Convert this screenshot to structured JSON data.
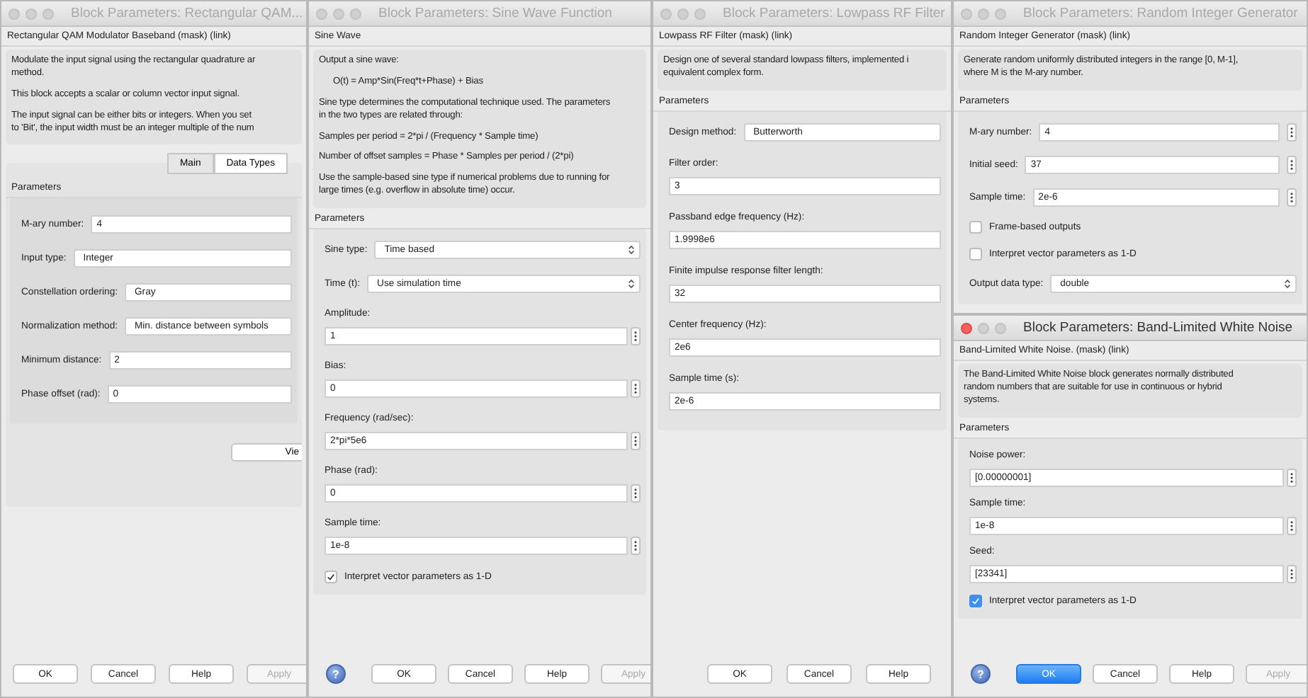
{
  "windows": [
    {
      "title": "Block Parameters: Rectangular QAM...",
      "active": false,
      "header": "Rectangular QAM Modulator Baseband (mask) (link)",
      "description": [
        {
          "indented": false,
          "lines": [
            "Modulate the input signal using the rectangular quadrature ar",
            "method."
          ]
        },
        {
          "indented": false,
          "lines": [
            "This block accepts a scalar or column vector input signal."
          ]
        },
        {
          "indented": false,
          "lines": [
            "The input signal can be either bits or integers. When you set",
            "to 'Bit', the input width must be an integer multiple of the num"
          ]
        }
      ],
      "tabs": [
        {
          "label": "Main",
          "selected": true
        },
        {
          "label": "Data Types",
          "selected": false
        }
      ],
      "params_title": "Parameters",
      "params": [
        {
          "kind": "inline-field",
          "label": "M-ary number:",
          "value": "4"
        },
        {
          "kind": "inline-select",
          "label": "Input type:",
          "value": "Integer"
        },
        {
          "kind": "inline-select",
          "label": "Constellation ordering:",
          "value": "Gray"
        },
        {
          "kind": "inline-select",
          "label": "Normalization method:",
          "value": "Min. distance between symbols"
        },
        {
          "kind": "inline-field",
          "label": "Minimum distance:",
          "value": "2"
        },
        {
          "kind": "inline-field",
          "label": "Phase offset (rad):",
          "value": "0"
        }
      ],
      "panel_button": "Vie",
      "buttons": [
        {
          "label": "OK",
          "default": false,
          "disabled": false
        },
        {
          "label": "Cancel",
          "default": false,
          "disabled": false
        },
        {
          "label": "Help",
          "default": false,
          "disabled": false
        },
        {
          "label": "Apply",
          "default": false,
          "disabled": true
        }
      ]
    },
    {
      "title": "Block Parameters: Sine Wave Function",
      "active": false,
      "header": "Sine Wave",
      "description": [
        {
          "indented": false,
          "lines": [
            "Output a sine wave:"
          ]
        },
        {
          "indented": true,
          "lines": [
            "O(t) = Amp*Sin(Freq*t+Phase) + Bias"
          ]
        },
        {
          "indented": false,
          "lines": [
            "Sine type determines the computational technique used. The parameters",
            "in the two types are related through:"
          ]
        },
        {
          "indented": false,
          "lines": [
            "Samples per period = 2*pi / (Frequency * Sample time)"
          ]
        },
        {
          "indented": false,
          "lines": [
            "Number of offset samples = Phase * Samples per period / (2*pi)"
          ]
        },
        {
          "indented": false,
          "lines": [
            "Use the sample-based sine type if numerical problems due to running for",
            "large times (e.g. overflow in absolute time) occur."
          ]
        }
      ],
      "params_title": "Parameters",
      "params": [
        {
          "kind": "inline-select",
          "label": "Sine type:",
          "value": "Time based",
          "chevron": true
        },
        {
          "kind": "inline-select",
          "label": "Time (t):",
          "value": "Use simulation time",
          "chevron": true
        },
        {
          "kind": "field",
          "label": "Amplitude:",
          "value": "1",
          "menu_button": true
        },
        {
          "kind": "field",
          "label": "Bias:",
          "value": "0",
          "menu_button": true
        },
        {
          "kind": "field",
          "label": "Frequency (rad/sec):",
          "value": "2*pi*5e6",
          "menu_button": true
        },
        {
          "kind": "field",
          "label": "Phase (rad):",
          "value": "0",
          "menu_button": true
        },
        {
          "kind": "field",
          "label": "Sample time:",
          "value": "1e-8",
          "menu_button": true
        },
        {
          "kind": "checkbox",
          "label": "Interpret vector parameters as 1-D",
          "checked": true
        }
      ],
      "help_button": "?",
      "buttons": [
        {
          "label": "OK",
          "default": false,
          "disabled": false
        },
        {
          "label": "Cancel",
          "default": false,
          "disabled": false
        },
        {
          "label": "Help",
          "default": false,
          "disabled": false
        },
        {
          "label": "Apply",
          "default": false,
          "disabled": true
        }
      ]
    },
    {
      "title": "Block Parameters: Lowpass RF Filter",
      "active": false,
      "header": "Lowpass RF Filter (mask) (link)",
      "description": [
        {
          "indented": false,
          "lines": [
            "Design one of several standard lowpass filters, implemented i",
            "equivalent complex form."
          ]
        }
      ],
      "params_title": "Parameters",
      "params": [
        {
          "kind": "inline-select",
          "label": "Design method:",
          "value": "Butterworth"
        },
        {
          "kind": "field",
          "label": "Filter order:",
          "value": "3"
        },
        {
          "kind": "field",
          "label": "Passband edge frequency (Hz):",
          "value": "1.9998e6"
        },
        {
          "kind": "field",
          "label": "Finite impulse response filter length:",
          "value": "32"
        },
        {
          "kind": "field",
          "label": "Center frequency (Hz):",
          "value": "2e6"
        },
        {
          "kind": "field",
          "label": "Sample time (s):",
          "value": "2e-6"
        }
      ],
      "buttons": [
        {
          "label": "OK",
          "default": false,
          "disabled": false
        },
        {
          "label": "Cancel",
          "default": false,
          "disabled": false
        },
        {
          "label": "Help",
          "default": false,
          "disabled": false
        }
      ]
    },
    {
      "title": "Block Parameters: Random Integer Generator",
      "active": false,
      "header": "Random Integer Generator (mask) (link)",
      "description": [
        {
          "indented": false,
          "lines": [
            "Generate random uniformly distributed integers in the range [0, M-1],",
            "where M is the M-ary number."
          ]
        }
      ],
      "params_title": "Parameters",
      "params": [
        {
          "kind": "inline-field",
          "label": "M-ary number:",
          "value": "4",
          "menu_button": true
        },
        {
          "kind": "inline-field",
          "label": "Initial seed:",
          "value": "37",
          "menu_button": true
        },
        {
          "kind": "inline-field",
          "label": "Sample time:",
          "value": "2e-6",
          "menu_button": true
        },
        {
          "kind": "checkbox",
          "label": "Frame-based outputs",
          "checked": false
        },
        {
          "kind": "checkbox",
          "label": "Interpret vector parameters as 1-D",
          "checked": false
        },
        {
          "kind": "inline-select",
          "label": "Output data type:",
          "value": "double",
          "chevron": true
        }
      ]
    },
    {
      "title": "Block Parameters: Band-Limited White Noise",
      "active": true,
      "header": "Band-Limited White Noise. (mask) (link)",
      "description": [
        {
          "indented": false,
          "lines": [
            "The Band-Limited White Noise block generates normally distributed",
            "random numbers that are suitable for use in continuous or hybrid",
            "systems."
          ]
        }
      ],
      "params_title": "Parameters",
      "params": [
        {
          "kind": "field",
          "label": "Noise power:",
          "value": "[0.00000001]",
          "menu_button": true
        },
        {
          "kind": "field",
          "label": "Sample time:",
          "value": "1e-8",
          "menu_button": true
        },
        {
          "kind": "field",
          "label": "Seed:",
          "value": "[23341]",
          "menu_button": true
        },
        {
          "kind": "checkbox",
          "label": "Interpret vector parameters as 1-D",
          "checked": true
        }
      ],
      "help_button": "?",
      "buttons": [
        {
          "label": "OK",
          "default": true,
          "disabled": false
        },
        {
          "label": "Cancel",
          "default": false,
          "disabled": false
        },
        {
          "label": "Help",
          "default": false,
          "disabled": false
        },
        {
          "label": "Apply",
          "default": false,
          "disabled": true
        }
      ]
    }
  ]
}
